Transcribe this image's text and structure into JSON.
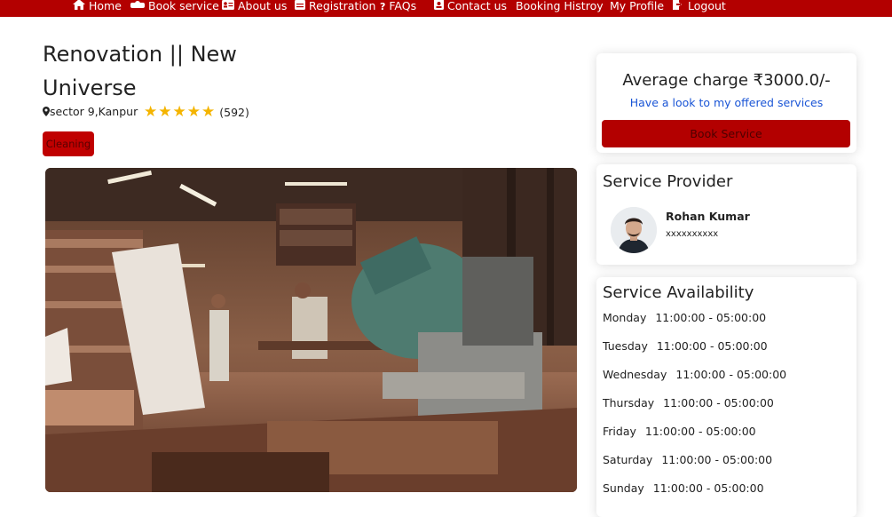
{
  "nav": {
    "items": [
      {
        "label": "Home",
        "icon": "home-icon"
      },
      {
        "label": "Book service",
        "icon": "tools-icon"
      },
      {
        "label": "About us",
        "icon": "id-card-icon"
      },
      {
        "label": "Registration",
        "icon": "register-icon"
      },
      {
        "label": "FAQs",
        "icon": "faq-icon"
      },
      {
        "label": "Contact us",
        "icon": "contact-icon"
      },
      {
        "label": "Booking Histroy",
        "icon": ""
      },
      {
        "label": "My Profile",
        "icon": ""
      },
      {
        "label": "Logout",
        "icon": "logout-icon"
      }
    ]
  },
  "service": {
    "title_line1": "Renovation || New",
    "title_line2": "Universe",
    "location": "sector 9,Kanpur",
    "rating_stars": 5,
    "review_count": "(592)",
    "category": "Cleaning"
  },
  "pricing": {
    "average_charge": "Average charge ₹3000.0/-",
    "services_link": "Have a look to my offered services",
    "book_button": "Book Service"
  },
  "provider": {
    "heading": "Service Provider",
    "name": "Rohan Kumar",
    "phone": "xxxxxxxxxx"
  },
  "availability": {
    "heading": "Service Availability",
    "rows": [
      {
        "day": "Monday",
        "hours": "11:00:00 - 05:00:00"
      },
      {
        "day": "Tuesday",
        "hours": "11:00:00 - 05:00:00"
      },
      {
        "day": "Wednesday",
        "hours": "11:00:00 - 05:00:00"
      },
      {
        "day": "Thursday",
        "hours": "11:00:00 - 05:00:00"
      },
      {
        "day": "Friday",
        "hours": "11:00:00 - 05:00:00"
      },
      {
        "day": "Saturday",
        "hours": "11:00:00 - 05:00:00"
      },
      {
        "day": "Sunday",
        "hours": "11:00:00 - 05:00:00"
      }
    ]
  },
  "colors": {
    "brand_red": "#b30000",
    "star_gold": "#f4b400",
    "link_blue": "#1a55d6"
  }
}
